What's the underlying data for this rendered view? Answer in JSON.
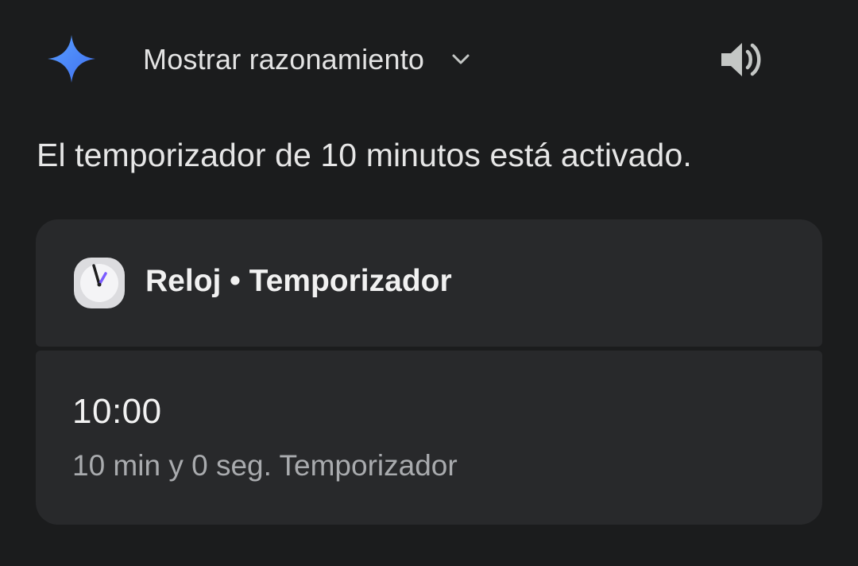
{
  "header": {
    "assistant_icon": "gemini-sparkle-icon",
    "reasoning_label": "Mostrar razonamiento",
    "expand_icon": "chevron-down-icon",
    "speaker_icon": "speaker-icon"
  },
  "response": {
    "text": "El temporizador de 10 minutos está activado."
  },
  "card": {
    "app_icon": "clock-app-icon",
    "title": "Reloj • Temporizador",
    "timer_value": "10:00",
    "timer_subtitle": "10 min y 0 seg. Temporizador"
  },
  "colors": {
    "background": "#1b1c1d",
    "card_background": "#28292b",
    "sparkle_blue": "#4a86f7",
    "clock_hand_purple": "#7b5cff",
    "secondary_text": "#a9abae"
  }
}
